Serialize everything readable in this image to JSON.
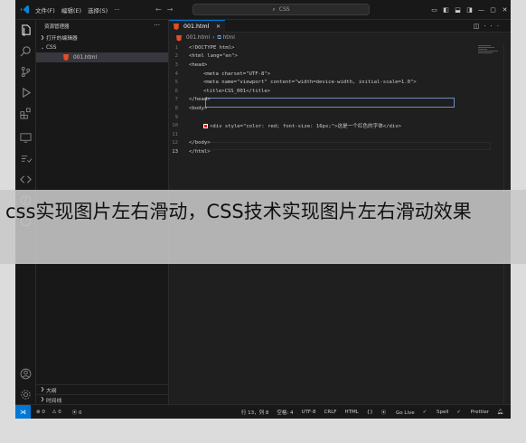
{
  "menu": {
    "file": "文件(F)",
    "edit": "编辑(E)",
    "selection": "选择(S)",
    "more": "···"
  },
  "search": {
    "placeholder": "CSS"
  },
  "window_controls": {
    "minimize": "—",
    "restore": "▢",
    "close": "✕"
  },
  "sidebar": {
    "header": "资源管理器",
    "more": "···",
    "open_editors": "打开的编辑器",
    "folder": "CSS",
    "file": "001.html",
    "outline": "大纲",
    "timeline": "时间线"
  },
  "tab": {
    "label": "001.html"
  },
  "breadcrumb": {
    "file": "001.html",
    "symbol": "html"
  },
  "code": {
    "lines": [
      {
        "n": "1",
        "t": "<!DOCTYPE html>"
      },
      {
        "n": "2",
        "t": "<html lang=\"en\">"
      },
      {
        "n": "3",
        "t": "<head>"
      },
      {
        "n": "4",
        "t": "<meta charset=\"UTF-8\">"
      },
      {
        "n": "5",
        "t": "<meta name=\"viewport\" content=\"width=device-width, initial-scale=1.0\">"
      },
      {
        "n": "6",
        "t": "<title>CSS_001</title>"
      },
      {
        "n": "7",
        "t": "</head>"
      },
      {
        "n": "8",
        "t": "<body>"
      },
      {
        "n": "9",
        "t": ""
      },
      {
        "n": "10",
        "t": "<div style=\"color: red; font-size: 16px;\">这是一个红色的字体</div>"
      },
      {
        "n": "11",
        "t": ""
      },
      {
        "n": "12",
        "t": "</body>"
      },
      {
        "n": "13",
        "t": "</html>"
      }
    ]
  },
  "status": {
    "errors": "0",
    "warnings": "0",
    "ports": "0",
    "position": "行 13，列 8",
    "spaces": "空格: 4",
    "encoding": "UTF-8",
    "eol": "CRLF",
    "language": "HTML",
    "golive": "Go Live",
    "spell": "Spell",
    "prettier": "Prettier"
  },
  "banner": {
    "text": "css实现图片左右滑动，CSS技术实现图片左右滑动效果"
  }
}
